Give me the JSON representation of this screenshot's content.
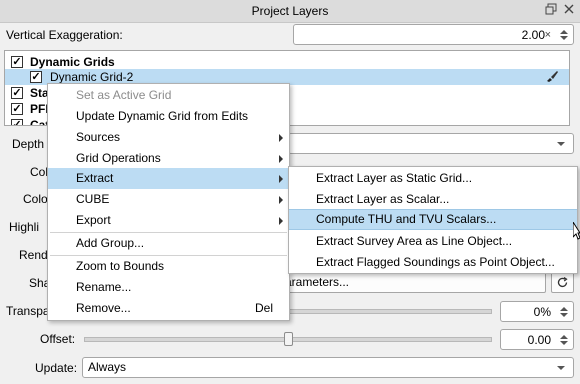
{
  "window": {
    "title": "Project Layers"
  },
  "vertical_exaggeration": {
    "label": "Vertical Exaggeration:",
    "value": "2.00",
    "clear_glyph": "×"
  },
  "tree": {
    "items": [
      {
        "label": "Dynamic Grids",
        "checked": true,
        "bold": true
      },
      {
        "label": "Dynamic Grid-2",
        "checked": true,
        "selected": true
      },
      {
        "label": "Stat",
        "checked": true,
        "bold": true
      },
      {
        "label": "PFM",
        "checked": true,
        "bold": true
      },
      {
        "label": "Cat",
        "checked": true,
        "bold": true
      }
    ]
  },
  "properties": {
    "depth_label": "Depth",
    "col1_label": "Col",
    "col2_label": "Colo",
    "highlight_label": "Highli",
    "render_label": "Rend",
    "shade_label": "Sha",
    "shade_button": "arameters...",
    "transparency_label": "Transpa",
    "transparency_value": "0%",
    "offset_label": "Offset:",
    "offset_value": "0.00",
    "update_label": "Update:",
    "update_value": "Always"
  },
  "context_menu": {
    "items": [
      {
        "label": "Set as Active Grid",
        "disabled": true
      },
      {
        "label": "Update Dynamic Grid from Edits"
      },
      {
        "label": "Sources",
        "submenu": true
      },
      {
        "label": "Grid Operations",
        "submenu": true
      },
      {
        "label": "Extract",
        "submenu": true,
        "highlighted": true
      },
      {
        "label": "CUBE",
        "submenu": true
      },
      {
        "label": "Export",
        "submenu": true
      },
      {
        "label": "Add Group..."
      },
      {
        "label": "Zoom to Bounds"
      },
      {
        "label": "Rename..."
      },
      {
        "label": "Remove...",
        "shortcut": "Del"
      }
    ]
  },
  "extract_submenu": {
    "items": [
      {
        "label": "Extract Layer as Static Grid..."
      },
      {
        "label": "Extract Layer as Scalar..."
      },
      {
        "label": "Compute THU and TVU Scalars...",
        "highlighted": true
      },
      {
        "label": "Extract Survey Area as Line Object..."
      },
      {
        "label": "Extract Flagged Soundings as Point Object..."
      }
    ]
  },
  "colors": {
    "highlight": "#bcdcf3",
    "accent": "#9ec8e6"
  }
}
